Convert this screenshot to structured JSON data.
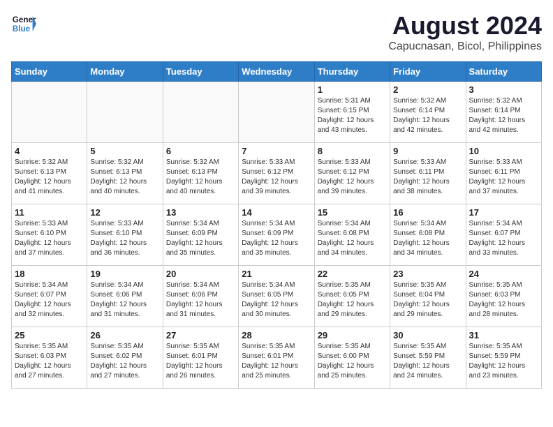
{
  "header": {
    "logo_line1": "General",
    "logo_line2": "Blue",
    "title": "August 2024",
    "subtitle": "Capucnasan, Bicol, Philippines"
  },
  "weekdays": [
    "Sunday",
    "Monday",
    "Tuesday",
    "Wednesday",
    "Thursday",
    "Friday",
    "Saturday"
  ],
  "weeks": [
    [
      {
        "num": "",
        "info": ""
      },
      {
        "num": "",
        "info": ""
      },
      {
        "num": "",
        "info": ""
      },
      {
        "num": "",
        "info": ""
      },
      {
        "num": "1",
        "info": "Sunrise: 5:31 AM\nSunset: 6:15 PM\nDaylight: 12 hours\nand 43 minutes."
      },
      {
        "num": "2",
        "info": "Sunrise: 5:32 AM\nSunset: 6:14 PM\nDaylight: 12 hours\nand 42 minutes."
      },
      {
        "num": "3",
        "info": "Sunrise: 5:32 AM\nSunset: 6:14 PM\nDaylight: 12 hours\nand 42 minutes."
      }
    ],
    [
      {
        "num": "4",
        "info": "Sunrise: 5:32 AM\nSunset: 6:13 PM\nDaylight: 12 hours\nand 41 minutes."
      },
      {
        "num": "5",
        "info": "Sunrise: 5:32 AM\nSunset: 6:13 PM\nDaylight: 12 hours\nand 40 minutes."
      },
      {
        "num": "6",
        "info": "Sunrise: 5:32 AM\nSunset: 6:13 PM\nDaylight: 12 hours\nand 40 minutes."
      },
      {
        "num": "7",
        "info": "Sunrise: 5:33 AM\nSunset: 6:12 PM\nDaylight: 12 hours\nand 39 minutes."
      },
      {
        "num": "8",
        "info": "Sunrise: 5:33 AM\nSunset: 6:12 PM\nDaylight: 12 hours\nand 39 minutes."
      },
      {
        "num": "9",
        "info": "Sunrise: 5:33 AM\nSunset: 6:11 PM\nDaylight: 12 hours\nand 38 minutes."
      },
      {
        "num": "10",
        "info": "Sunrise: 5:33 AM\nSunset: 6:11 PM\nDaylight: 12 hours\nand 37 minutes."
      }
    ],
    [
      {
        "num": "11",
        "info": "Sunrise: 5:33 AM\nSunset: 6:10 PM\nDaylight: 12 hours\nand 37 minutes."
      },
      {
        "num": "12",
        "info": "Sunrise: 5:33 AM\nSunset: 6:10 PM\nDaylight: 12 hours\nand 36 minutes."
      },
      {
        "num": "13",
        "info": "Sunrise: 5:34 AM\nSunset: 6:09 PM\nDaylight: 12 hours\nand 35 minutes."
      },
      {
        "num": "14",
        "info": "Sunrise: 5:34 AM\nSunset: 6:09 PM\nDaylight: 12 hours\nand 35 minutes."
      },
      {
        "num": "15",
        "info": "Sunrise: 5:34 AM\nSunset: 6:08 PM\nDaylight: 12 hours\nand 34 minutes."
      },
      {
        "num": "16",
        "info": "Sunrise: 5:34 AM\nSunset: 6:08 PM\nDaylight: 12 hours\nand 34 minutes."
      },
      {
        "num": "17",
        "info": "Sunrise: 5:34 AM\nSunset: 6:07 PM\nDaylight: 12 hours\nand 33 minutes."
      }
    ],
    [
      {
        "num": "18",
        "info": "Sunrise: 5:34 AM\nSunset: 6:07 PM\nDaylight: 12 hours\nand 32 minutes."
      },
      {
        "num": "19",
        "info": "Sunrise: 5:34 AM\nSunset: 6:06 PM\nDaylight: 12 hours\nand 31 minutes."
      },
      {
        "num": "20",
        "info": "Sunrise: 5:34 AM\nSunset: 6:06 PM\nDaylight: 12 hours\nand 31 minutes."
      },
      {
        "num": "21",
        "info": "Sunrise: 5:34 AM\nSunset: 6:05 PM\nDaylight: 12 hours\nand 30 minutes."
      },
      {
        "num": "22",
        "info": "Sunrise: 5:35 AM\nSunset: 6:05 PM\nDaylight: 12 hours\nand 29 minutes."
      },
      {
        "num": "23",
        "info": "Sunrise: 5:35 AM\nSunset: 6:04 PM\nDaylight: 12 hours\nand 29 minutes."
      },
      {
        "num": "24",
        "info": "Sunrise: 5:35 AM\nSunset: 6:03 PM\nDaylight: 12 hours\nand 28 minutes."
      }
    ],
    [
      {
        "num": "25",
        "info": "Sunrise: 5:35 AM\nSunset: 6:03 PM\nDaylight: 12 hours\nand 27 minutes."
      },
      {
        "num": "26",
        "info": "Sunrise: 5:35 AM\nSunset: 6:02 PM\nDaylight: 12 hours\nand 27 minutes."
      },
      {
        "num": "27",
        "info": "Sunrise: 5:35 AM\nSunset: 6:01 PM\nDaylight: 12 hours\nand 26 minutes."
      },
      {
        "num": "28",
        "info": "Sunrise: 5:35 AM\nSunset: 6:01 PM\nDaylight: 12 hours\nand 25 minutes."
      },
      {
        "num": "29",
        "info": "Sunrise: 5:35 AM\nSunset: 6:00 PM\nDaylight: 12 hours\nand 25 minutes."
      },
      {
        "num": "30",
        "info": "Sunrise: 5:35 AM\nSunset: 5:59 PM\nDaylight: 12 hours\nand 24 minutes."
      },
      {
        "num": "31",
        "info": "Sunrise: 5:35 AM\nSunset: 5:59 PM\nDaylight: 12 hours\nand 23 minutes."
      }
    ]
  ]
}
